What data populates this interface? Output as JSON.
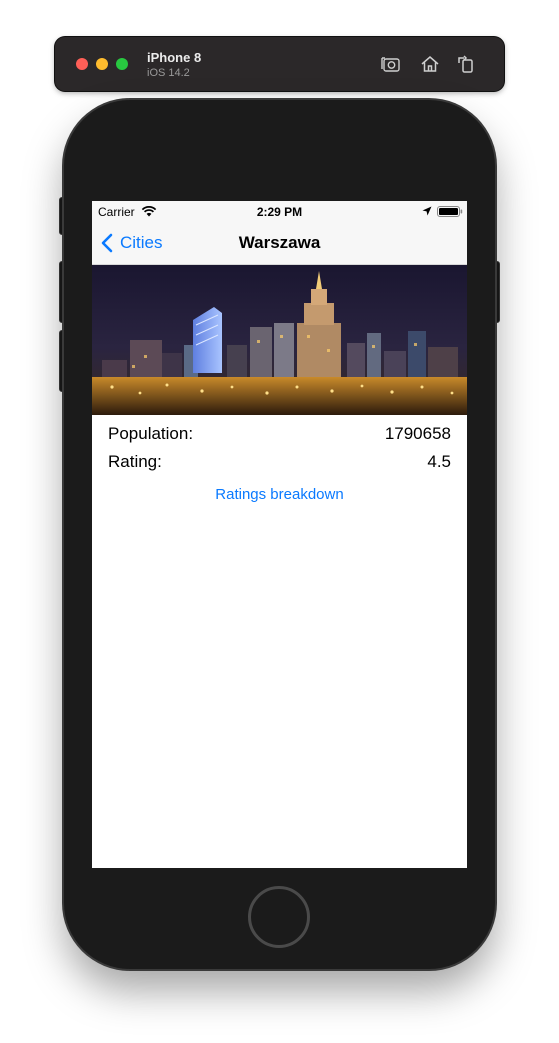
{
  "simulator": {
    "device_name": "iPhone 8",
    "os_version": "iOS 14.2",
    "tools": [
      "screenshot-icon",
      "home-icon",
      "rotate-icon"
    ]
  },
  "status_bar": {
    "carrier": "Carrier",
    "time": "2:29 PM"
  },
  "nav": {
    "back_label": "Cities",
    "title": "Warszawa"
  },
  "city": {
    "image_alt": "Warszawa skyline at night",
    "population_label": "Population:",
    "population_value": "1790658",
    "rating_label": "Rating:",
    "rating_value": "4.5",
    "breakdown_link": "Ratings breakdown"
  },
  "colors": {
    "accent": "#0a7aff",
    "sim_bar": "#2b2829",
    "device_body": "#1b1b1b"
  }
}
